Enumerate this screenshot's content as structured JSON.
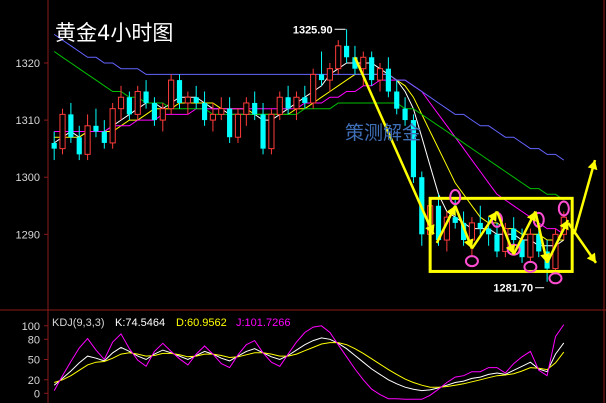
{
  "chart_data": [
    {
      "type": "candlestick",
      "title": "黄金4小时图",
      "watermark": "策测解金",
      "y_ticks": [
        1320,
        1310,
        1300,
        1290
      ],
      "ylim": [
        1278.5,
        1330.5
      ],
      "high_label": "1325.90",
      "low_label": "1281.70",
      "ohlc": [
        [
          1306,
          1308,
          1303,
          1305
        ],
        [
          1305,
          1312,
          1304,
          1311
        ],
        [
          1311,
          1313,
          1306,
          1307
        ],
        [
          1307,
          1309,
          1303,
          1304
        ],
        [
          1304,
          1311,
          1303,
          1309
        ],
        [
          1309,
          1312,
          1307,
          1308
        ],
        [
          1308,
          1310,
          1305,
          1306
        ],
        [
          1306,
          1313,
          1305,
          1312
        ],
        [
          1312,
          1316,
          1310,
          1314
        ],
        [
          1314,
          1315,
          1310,
          1311
        ],
        [
          1311,
          1316,
          1310,
          1315
        ],
        [
          1315,
          1317,
          1312,
          1313
        ],
        [
          1313,
          1314,
          1309,
          1310
        ],
        [
          1310,
          1313,
          1308,
          1312
        ],
        [
          1312,
          1318,
          1311,
          1317
        ],
        [
          1317,
          1318,
          1312,
          1313
        ],
        [
          1313,
          1315,
          1311,
          1314
        ],
        [
          1314,
          1316,
          1312,
          1313
        ],
        [
          1313,
          1315,
          1309,
          1310
        ],
        [
          1310,
          1313,
          1308,
          1311
        ],
        [
          1311,
          1314,
          1310,
          1312
        ],
        [
          1312,
          1314,
          1306,
          1307
        ],
        [
          1307,
          1312,
          1306,
          1311
        ],
        [
          1311,
          1314,
          1309,
          1313
        ],
        [
          1313,
          1315,
          1310,
          1311
        ],
        [
          1311,
          1313,
          1304,
          1305
        ],
        [
          1305,
          1312,
          1304,
          1311
        ],
        [
          1311,
          1315,
          1310,
          1314
        ],
        [
          1314,
          1316,
          1311,
          1312
        ],
        [
          1312,
          1315,
          1310,
          1314
        ],
        [
          1314,
          1316,
          1312,
          1313
        ],
        [
          1313,
          1319,
          1312,
          1318
        ],
        [
          1318,
          1322,
          1316,
          1317
        ],
        [
          1317,
          1320,
          1315,
          1319
        ],
        [
          1319,
          1324,
          1318,
          1323
        ],
        [
          1323,
          1325.9,
          1320,
          1321
        ],
        [
          1321,
          1323,
          1318,
          1319
        ],
        [
          1319,
          1322,
          1316,
          1321
        ],
        [
          1321,
          1322,
          1316,
          1317
        ],
        [
          1317,
          1320,
          1315,
          1319
        ],
        [
          1319,
          1321,
          1314,
          1315
        ],
        [
          1315,
          1317,
          1311,
          1312
        ],
        [
          1312,
          1314,
          1309,
          1310
        ],
        [
          1310,
          1311,
          1299,
          1300
        ],
        [
          1300,
          1301,
          1288,
          1290
        ],
        [
          1290,
          1296,
          1289,
          1295
        ],
        [
          1295,
          1297,
          1288,
          1289
        ],
        [
          1289,
          1294,
          1287,
          1293
        ],
        [
          1293,
          1296,
          1291,
          1292
        ],
        [
          1292,
          1294,
          1288,
          1289
        ],
        [
          1289,
          1293,
          1286,
          1292
        ],
        [
          1292,
          1295,
          1290,
          1291
        ],
        [
          1291,
          1293,
          1288,
          1290
        ],
        [
          1290,
          1292,
          1286,
          1287
        ],
        [
          1287,
          1292,
          1286,
          1291
        ],
        [
          1291,
          1293,
          1288,
          1289
        ],
        [
          1289,
          1291,
          1285,
          1286
        ],
        [
          1286,
          1291,
          1285,
          1290
        ],
        [
          1290,
          1292,
          1286,
          1287
        ],
        [
          1287,
          1289,
          1281.7,
          1284
        ],
        [
          1284,
          1291,
          1283,
          1290
        ],
        [
          1290,
          1294,
          1289,
          1293
        ]
      ],
      "ma_series": [
        {
          "color": "#ffffff",
          "values": [
            1306,
            1307,
            1308,
            1307,
            1308,
            1308,
            1308,
            1309,
            1310,
            1311,
            1312,
            1313,
            1313,
            1312,
            1313,
            1314,
            1314,
            1314,
            1313,
            1312,
            1312,
            1311,
            1311,
            1311,
            1311,
            1310,
            1310,
            1311,
            1312,
            1313,
            1314,
            1315,
            1316,
            1318,
            1319,
            1320,
            1320,
            1320,
            1320,
            1319,
            1318,
            1317,
            1315,
            1312,
            1307,
            1302,
            1297,
            1294,
            1293,
            1292,
            1291,
            1291,
            1291,
            1290,
            1290,
            1290,
            1289,
            1289,
            1288,
            1288,
            1288,
            1289
          ]
        },
        {
          "color": "#ffff00",
          "values": [
            1307,
            1307,
            1307,
            1307,
            1308,
            1308,
            1308,
            1308,
            1309,
            1310,
            1310,
            1311,
            1312,
            1312,
            1312,
            1313,
            1313,
            1313,
            1313,
            1313,
            1312,
            1312,
            1312,
            1312,
            1311,
            1311,
            1311,
            1311,
            1311,
            1312,
            1312,
            1313,
            1314,
            1315,
            1316,
            1317,
            1318,
            1318,
            1318,
            1318,
            1318,
            1317,
            1316,
            1314,
            1311,
            1308,
            1305,
            1302,
            1299,
            1297,
            1295,
            1293,
            1292,
            1292,
            1291,
            1291,
            1290,
            1290,
            1290,
            1289,
            1289,
            1289
          ]
        },
        {
          "color": "#ff00ff",
          "values": [
            1308,
            1308,
            1308,
            1308,
            1308,
            1308,
            1308,
            1309,
            1309,
            1309,
            1310,
            1310,
            1310,
            1311,
            1311,
            1311,
            1311,
            1312,
            1312,
            1312,
            1312,
            1312,
            1312,
            1312,
            1312,
            1312,
            1312,
            1312,
            1312,
            1312,
            1313,
            1313,
            1313,
            1314,
            1314,
            1315,
            1315,
            1316,
            1316,
            1317,
            1317,
            1317,
            1317,
            1316,
            1315,
            1313,
            1311,
            1309,
            1307,
            1305,
            1303,
            1301,
            1299,
            1297,
            1296,
            1295,
            1294,
            1293,
            1292,
            1291,
            1291,
            1290
          ]
        },
        {
          "color": "#00c000",
          "values": [
            1322,
            1321,
            1320,
            1319,
            1318,
            1317,
            1316,
            1315,
            1315,
            1314,
            1314,
            1313,
            1313,
            1313,
            1312,
            1312,
            1312,
            1312,
            1312,
            1311,
            1311,
            1311,
            1311,
            1311,
            1311,
            1311,
            1311,
            1311,
            1311,
            1311,
            1312,
            1312,
            1312,
            1312,
            1313,
            1313,
            1313,
            1313,
            1313,
            1313,
            1313,
            1313,
            1312,
            1312,
            1311,
            1310,
            1309,
            1308,
            1307,
            1306,
            1305,
            1304,
            1303,
            1302,
            1301,
            1300,
            1299,
            1298,
            1298,
            1297,
            1297,
            1296
          ]
        },
        {
          "color": "#6464ff",
          "values": [
            1325,
            1324,
            1323,
            1322,
            1321,
            1321,
            1320,
            1320,
            1319,
            1319,
            1319,
            1318,
            1318,
            1318,
            1318,
            1318,
            1318,
            1318,
            1318,
            1318,
            1318,
            1318,
            1318,
            1318,
            1318,
            1318,
            1318,
            1318,
            1318,
            1318,
            1318,
            1318,
            1318,
            1318,
            1318,
            1318,
            1318,
            1318,
            1318,
            1318,
            1318,
            1317,
            1317,
            1316,
            1315,
            1314,
            1313,
            1312,
            1311,
            1311,
            1310,
            1309,
            1309,
            1308,
            1307,
            1307,
            1306,
            1305,
            1305,
            1304,
            1304,
            1303
          ]
        }
      ],
      "markers": {
        "peaks": [
          48,
          53,
          58,
          61
        ],
        "troughs": [
          50,
          55,
          57,
          60
        ],
        "box": {
          "x": [
            45.5,
            62.5
          ],
          "y": [
            1283.5,
            1296.3
          ]
        }
      }
    },
    {
      "type": "line",
      "title": "KDJ(9,3,3)",
      "legend": [
        {
          "label": "K:74.5464",
          "color": "#ffffff"
        },
        {
          "label": "D:60.9562",
          "color": "#ffff00"
        },
        {
          "label": "J:101.7266",
          "color": "#ff00ff"
        }
      ],
      "y_ticks": [
        100,
        80,
        50,
        20,
        0
      ],
      "ylim": [
        -10,
        113
      ],
      "series": [
        {
          "name": "K",
          "color": "#ffffff",
          "values": [
            12,
            22,
            33,
            45,
            55,
            52,
            48,
            60,
            68,
            62,
            55,
            50,
            58,
            64,
            60,
            55,
            50,
            56,
            62,
            58,
            52,
            48,
            55,
            62,
            66,
            60,
            54,
            50,
            56,
            64,
            72,
            78,
            82,
            80,
            74,
            66,
            56,
            46,
            36,
            28,
            20,
            14,
            9,
            6,
            4,
            5,
            8,
            12,
            16,
            18,
            22,
            24,
            28,
            30,
            28,
            34,
            40,
            46,
            36,
            32,
            58,
            74.5464
          ]
        },
        {
          "name": "D",
          "color": "#ffff00",
          "values": [
            16,
            20,
            26,
            34,
            42,
            46,
            47,
            52,
            58,
            60,
            58,
            55,
            56,
            59,
            59,
            57,
            54,
            55,
            58,
            58,
            56,
            53,
            54,
            57,
            60,
            60,
            58,
            55,
            55,
            58,
            63,
            68,
            73,
            75,
            75,
            72,
            66,
            59,
            51,
            43,
            35,
            28,
            21,
            16,
            12,
            9,
            9,
            10,
            12,
            14,
            17,
            20,
            23,
            26,
            27,
            29,
            33,
            38,
            37,
            35,
            45,
            60.9562
          ]
        },
        {
          "name": "J",
          "color": "#ff00ff",
          "values": [
            4,
            26,
            47,
            67,
            81,
            64,
            50,
            76,
            88,
            66,
            49,
            40,
            62,
            74,
            62,
            51,
            42,
            58,
            70,
            58,
            44,
            38,
            57,
            72,
            78,
            60,
            46,
            40,
            58,
            76,
            90,
            98,
            100,
            90,
            72,
            54,
            36,
            20,
            6,
            -2,
            -8,
            -8,
            -9,
            -9,
            -9,
            -3,
            6,
            16,
            24,
            26,
            32,
            32,
            38,
            38,
            30,
            44,
            54,
            62,
            34,
            26,
            84,
            101.7266
          ]
        }
      ]
    }
  ]
}
